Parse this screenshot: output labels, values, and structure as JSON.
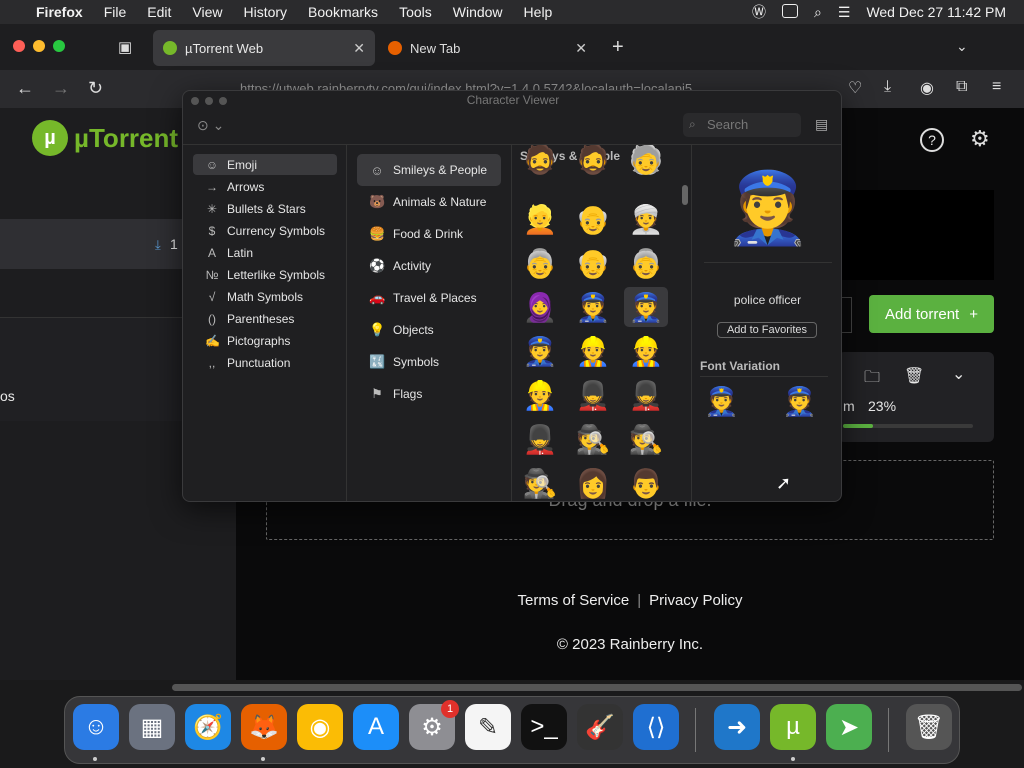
{
  "menubar": {
    "app_name": "Firefox",
    "items": [
      "File",
      "Edit",
      "View",
      "History",
      "Bookmarks",
      "Tools",
      "Window",
      "Help"
    ],
    "clock": "Wed Dec 27  11:42 PM"
  },
  "browser": {
    "active_tab": "µTorrent Web",
    "second_tab": "New Tab",
    "url": "https://utweb.rainberrytv.com/gui/index.html?v=1.4.0.5742&localauth=localapi5"
  },
  "utorrent": {
    "logo_text": "µTorrent W",
    "download_count": "1",
    "sidebar_partial_1": "o",
    "sidebar_partial_2": "os",
    "add_torrent": "Add torrent",
    "progress_partial": "m",
    "progress_percent": "23%",
    "progress_fraction": 0.23,
    "dropzone": "Drag and drop a file.",
    "terms": "Terms of Service",
    "privacy": "Privacy Policy",
    "copyright": "© 2023 Rainberry Inc."
  },
  "character_viewer": {
    "title": "Character Viewer",
    "search_placeholder": "Search",
    "categories": [
      {
        "icon": "☺",
        "label": "Emoji"
      },
      {
        "icon": "→",
        "label": "Arrows"
      },
      {
        "icon": "✳",
        "label": "Bullets & Stars"
      },
      {
        "icon": "$",
        "label": "Currency Symbols"
      },
      {
        "icon": "A",
        "label": "Latin"
      },
      {
        "icon": "№",
        "label": "Letterlike Symbols"
      },
      {
        "icon": "√",
        "label": "Math Symbols"
      },
      {
        "icon": "()",
        "label": "Parentheses"
      },
      {
        "icon": "✍",
        "label": "Pictographs"
      },
      {
        "icon": ",,",
        "label": "Punctuation"
      }
    ],
    "subcategories": [
      {
        "icon": "☺",
        "label": "Smileys & People"
      },
      {
        "icon": "🐻",
        "label": "Animals & Nature"
      },
      {
        "icon": "🍔",
        "label": "Food & Drink"
      },
      {
        "icon": "⚽",
        "label": "Activity"
      },
      {
        "icon": "🚗",
        "label": "Travel & Places"
      },
      {
        "icon": "💡",
        "label": "Objects"
      },
      {
        "icon": "🔣",
        "label": "Symbols"
      },
      {
        "icon": "⚑",
        "label": "Flags"
      }
    ],
    "grid_heading": "Smileys & People",
    "emojis": [
      [
        "🧔",
        "🧔",
        "🧓"
      ],
      [
        "👱",
        "👴",
        "👳"
      ],
      [
        "👵",
        "👴",
        "👵"
      ],
      [
        "🧕",
        "👮",
        "👮"
      ],
      [
        "👮",
        "👷",
        "👷"
      ],
      [
        "👷",
        "💂",
        "💂"
      ],
      [
        "💂",
        "🕵",
        "🕵"
      ],
      [
        "🕵",
        "👩",
        "👨"
      ]
    ],
    "selected_name": "police officer",
    "add_favorites": "Add to Favorites",
    "font_variation": "Font Variation",
    "preview_emoji": "👮",
    "variations": [
      "👮",
      "👮"
    ]
  },
  "dock": {
    "apps": [
      {
        "name": "finder",
        "glyph": "☺",
        "color": "#2b7be4"
      },
      {
        "name": "launchpad",
        "glyph": "▦",
        "color": "#6b7280"
      },
      {
        "name": "safari",
        "glyph": "🧭",
        "color": "#1e88e5"
      },
      {
        "name": "firefox",
        "glyph": "🦊",
        "color": "#e66000"
      },
      {
        "name": "chrome",
        "glyph": "◉",
        "color": "#fbbc05"
      },
      {
        "name": "app-store",
        "glyph": "A",
        "color": "#1c8ef9"
      },
      {
        "name": "system-settings",
        "glyph": "⚙",
        "color": "#8e8e93"
      },
      {
        "name": "textedit",
        "glyph": "✎",
        "color": "#f5f5f5"
      },
      {
        "name": "terminal",
        "glyph": ">_",
        "color": "#111"
      },
      {
        "name": "garageband",
        "glyph": "🎸",
        "color": "#333"
      },
      {
        "name": "vscode",
        "glyph": "⟨⟩",
        "color": "#1f6fd1"
      },
      {
        "name": "migration",
        "glyph": "➜",
        "color": "#1f77c9"
      },
      {
        "name": "utorrent",
        "glyph": "µ",
        "color": "#76b82a"
      },
      {
        "name": "maps",
        "glyph": "➤",
        "color": "#4caf50"
      },
      {
        "name": "trash",
        "glyph": "🗑",
        "color": "#555"
      }
    ],
    "settings_badge": "1"
  }
}
